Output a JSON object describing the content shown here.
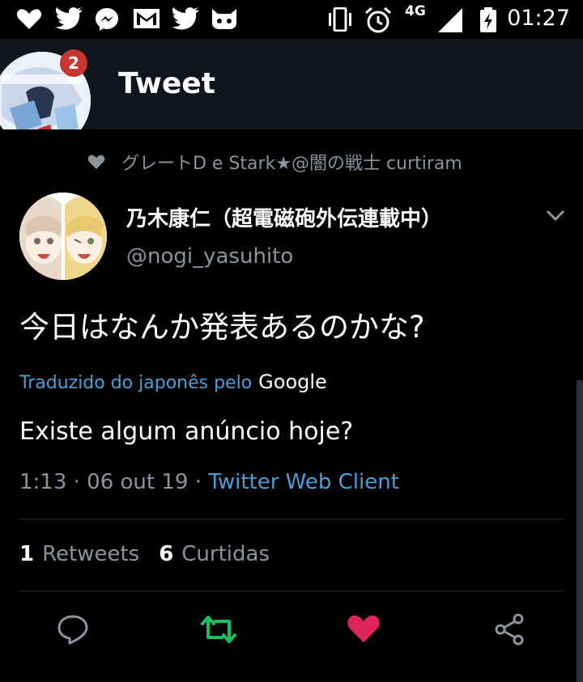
{
  "status_bar": {
    "time": "01:27",
    "network": "4G",
    "icons": [
      "heart-icon",
      "twitter-icon",
      "messenger-icon",
      "gmail-icon",
      "twitter-icon",
      "cat-icon",
      "vibrate-icon",
      "alarm-icon",
      "signal-icon",
      "battery-charging-icon"
    ]
  },
  "app_bar": {
    "title": "Tweet",
    "notification_count": "2"
  },
  "liked_by": {
    "text": "グレートD e Stark★@闇の戦士 curtiram",
    "icon": "heart-icon"
  },
  "tweet": {
    "author_name": "乃木康仁（超電磁砲外伝連載中）",
    "author_handle": "@nogi_yasuhito",
    "text": "今日はなんか発表あるのかな?",
    "translated_label": "Traduzido do japonês pelo",
    "translator": "Google",
    "translation": "Existe algum anúncio hoje?",
    "timestamp": "1:13 · 06 out 19 · ",
    "client": "Twitter Web Client"
  },
  "stats": {
    "retweets_count": "1",
    "retweets_label": "Retweets",
    "likes_count": "6",
    "likes_label": "Curtidas"
  },
  "actions": [
    "reply-icon",
    "retweet-icon",
    "like-icon",
    "share-icon"
  ],
  "colors": {
    "background": "#000000",
    "app_bar": "#10141c",
    "muted_text": "#8a939e",
    "link_blue": "#4a9fd8",
    "retweet_green": "#17bf63",
    "like_red": "#e0245e"
  }
}
